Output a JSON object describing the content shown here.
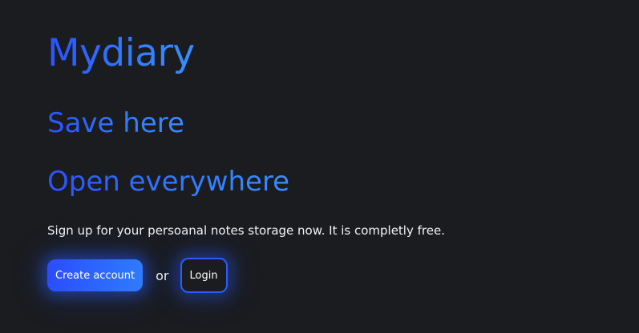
{
  "hero": {
    "title": "Mydiary",
    "tagline_1": "Save here",
    "tagline_2": "Open everywhere",
    "description": "Sign up for your persoanal notes storage now. It is completly free."
  },
  "actions": {
    "create_account_label": "Create account",
    "separator": "or",
    "login_label": "Login"
  },
  "colors": {
    "background": "#1b1c1f",
    "accent_start": "#2a4dff",
    "accent_end": "#2f7bff",
    "text": "#f2f3f5"
  }
}
